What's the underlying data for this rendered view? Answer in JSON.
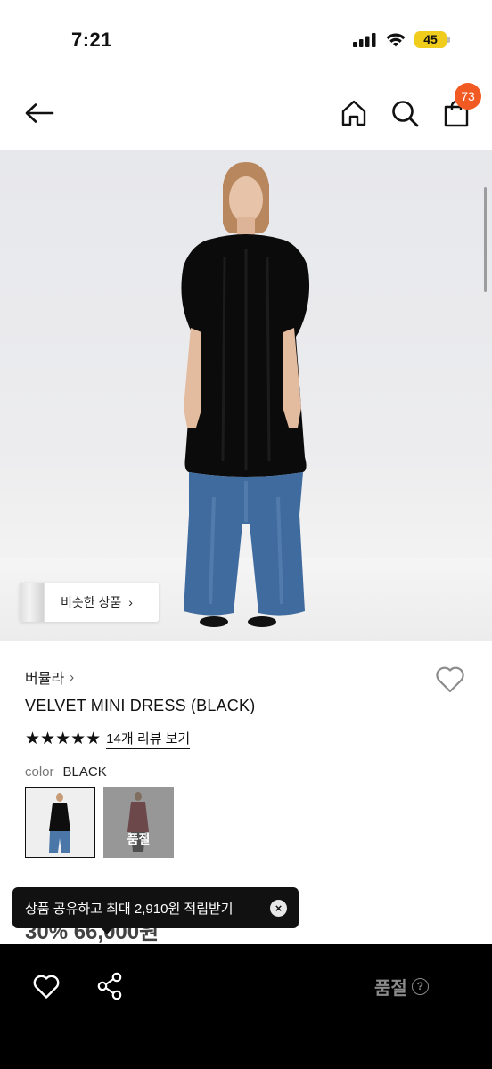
{
  "status_bar": {
    "time": "7:21",
    "battery": "45",
    "battery_color": "#f0cc1c"
  },
  "header": {
    "back_icon": "arrow-left-icon",
    "home_icon": "home-icon",
    "search_icon": "search-icon",
    "cart_icon": "shopping-bag-icon",
    "cart_count": "73",
    "badge_color": "#f15a22"
  },
  "product_image": {
    "similar_button_label": "비슷한 상품",
    "similar_button_chevron": "›"
  },
  "product": {
    "brand": "버뮬라",
    "brand_chevron": "›",
    "title": "VELVET MINI DRESS (BLACK)",
    "rating_stars": "★★★★★",
    "rating_value": 5,
    "review_link": "14개 리뷰 보기",
    "color_label": "color",
    "color_value": "BLACK",
    "swatches": [
      {
        "color": "BLACK",
        "selected": true,
        "sold_out": false
      },
      {
        "color": "RED",
        "selected": false,
        "sold_out": true,
        "label": "품절"
      }
    ],
    "price_partial": "30% 66,000원"
  },
  "toast": {
    "message": "상품 공유하고 최대 2,910원 적립받기",
    "close_icon": "close-circle-icon"
  },
  "bottom_bar": {
    "like_icon": "heart-outline-icon",
    "share_icon": "share-icon",
    "soldout_label": "품절",
    "help_icon": "question-circle-icon",
    "help_glyph": "?"
  }
}
